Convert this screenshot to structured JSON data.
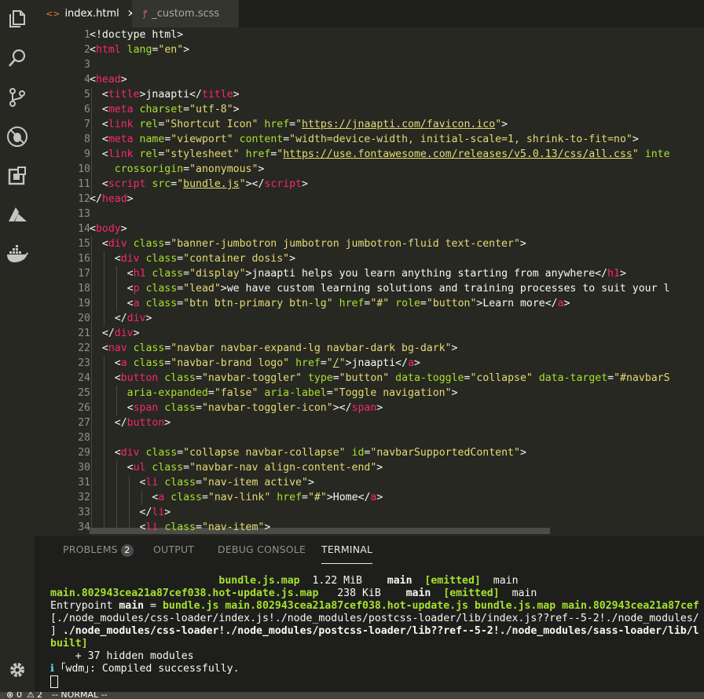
{
  "tabs": [
    {
      "icon": "html-icon",
      "icon_glyph": "<>",
      "label": "index.html",
      "close": "×"
    },
    {
      "icon": "scss-icon",
      "icon_glyph": "ꝭ",
      "label": "_custom.scss"
    }
  ],
  "activity_bar": [
    "files-icon",
    "search-icon",
    "source-control-icon",
    "debug-icon",
    "extensions-icon",
    "azure-icon",
    "docker-icon",
    "settings-gear-icon"
  ],
  "editor": {
    "lines": [
      {
        "n": "1",
        "html": "&lt;!doctype html&gt;"
      },
      {
        "n": "2",
        "html": "&lt;<span class=\"t\">html</span> <span class=\"a\">lang</span>=<span class=\"s\">\"en\"</span>&gt;"
      },
      {
        "n": "3",
        "html": ""
      },
      {
        "n": "4",
        "html": "&lt;<span class=\"t\">head</span>&gt;"
      },
      {
        "n": "5",
        "html": "  &lt;<span class=\"t\">title</span>&gt;jnaapti&lt;/<span class=\"t\">title</span>&gt;"
      },
      {
        "n": "6",
        "html": "  &lt;<span class=\"t\">meta</span> <span class=\"a\">charset</span>=<span class=\"s\">\"utf-8\"</span>&gt;"
      },
      {
        "n": "7",
        "html": "  &lt;<span class=\"t\">link</span> <span class=\"a\">rel</span>=<span class=\"s\">\"Shortcut Icon\"</span> <span class=\"a\">href</span>=<span class=\"s\">\"</span><span class=\"u\">https://jnaapti.com/favicon.ico</span><span class=\"s\">\"</span>&gt;"
      },
      {
        "n": "8",
        "html": "  &lt;<span class=\"t\">meta</span> <span class=\"a\">name</span>=<span class=\"s\">\"viewport\"</span> <span class=\"a\">content</span>=<span class=\"s\">\"width=device-width, initial-scale=1, shrink-to-fit=no\"</span>&gt;"
      },
      {
        "n": "9",
        "html": "  &lt;<span class=\"t\">link</span> <span class=\"a\">rel</span>=<span class=\"s\">\"stylesheet\"</span> <span class=\"a\">href</span>=<span class=\"s\">\"</span><span class=\"u\">https://use.fontawesome.com/releases/v5.0.13/css/all.css</span><span class=\"s\">\"</span> <span class=\"a\">inte</span>"
      },
      {
        "n": "10",
        "html": "    <span class=\"a\">crossorigin</span>=<span class=\"s\">\"anonymous\"</span>&gt;"
      },
      {
        "n": "11",
        "html": "  &lt;<span class=\"t\">script</span> <span class=\"a\">src</span>=<span class=\"s\">\"</span><span class=\"u\">bundle.js</span><span class=\"s\">\"</span>&gt;&lt;/<span class=\"t\">script</span>&gt;"
      },
      {
        "n": "12",
        "html": "&lt;/<span class=\"t\">head</span>&gt;"
      },
      {
        "n": "13",
        "html": ""
      },
      {
        "n": "14",
        "html": "&lt;<span class=\"t\">body</span>&gt;"
      },
      {
        "n": "15",
        "html": "  &lt;<span class=\"t\">div</span> <span class=\"a\">class</span>=<span class=\"s\">\"banner-jumbotron jumbotron jumbotron-fluid text-center\"</span>&gt;"
      },
      {
        "n": "16",
        "html": "    &lt;<span class=\"t\">div</span> <span class=\"a\">class</span>=<span class=\"s\">\"container dosis\"</span>&gt;"
      },
      {
        "n": "17",
        "html": "      &lt;<span class=\"t\">h1</span> <span class=\"a\">class</span>=<span class=\"s\">\"display\"</span>&gt;jnaapti helps you learn anything starting from anywhere&lt;/<span class=\"t\">h1</span>&gt;"
      },
      {
        "n": "18",
        "html": "      &lt;<span class=\"t\">p</span> <span class=\"a\">class</span>=<span class=\"s\">\"lead\"</span>&gt;we have custom learning solutions and training processes to suit your l"
      },
      {
        "n": "19",
        "html": "      &lt;<span class=\"t\">a</span> <span class=\"a\">class</span>=<span class=\"s\">\"btn btn-primary btn-lg\"</span> <span class=\"a\">href</span>=<span class=\"s\">\"#\"</span> <span class=\"a\">role</span>=<span class=\"s\">\"button\"</span>&gt;Learn more&lt;/<span class=\"t\">a</span>&gt;"
      },
      {
        "n": "20",
        "html": "    &lt;/<span class=\"t\">div</span>&gt;"
      },
      {
        "n": "21",
        "html": "  &lt;/<span class=\"t\">div</span>&gt;"
      },
      {
        "n": "22",
        "html": "  &lt;<span class=\"t\">nav</span> <span class=\"a\">class</span>=<span class=\"s\">\"navbar navbar-expand-lg navbar-dark bg-dark\"</span>&gt;"
      },
      {
        "n": "23",
        "html": "    &lt;<span class=\"t\">a</span> <span class=\"a\">class</span>=<span class=\"s\">\"navbar-brand logo\"</span> <span class=\"a\">href</span>=<span class=\"s\">\"</span><span class=\"u\">/</span><span class=\"s\">\"</span>&gt;jnaapti&lt;/<span class=\"t\">a</span>&gt;"
      },
      {
        "n": "24",
        "html": "    &lt;<span class=\"t\">button</span> <span class=\"a\">class</span>=<span class=\"s\">\"navbar-toggler\"</span> <span class=\"a\">type</span>=<span class=\"s\">\"button\"</span> <span class=\"a\">data-toggle</span>=<span class=\"s\">\"collapse\"</span> <span class=\"a\">data-target</span>=<span class=\"s\">\"#navbarS</span>"
      },
      {
        "n": "25",
        "html": "      <span class=\"a\">aria-expanded</span>=<span class=\"s\">\"false\"</span> <span class=\"a\">aria-label</span>=<span class=\"s\">\"Toggle navigation\"</span>&gt;"
      },
      {
        "n": "26",
        "html": "      &lt;<span class=\"t\">span</span> <span class=\"a\">class</span>=<span class=\"s\">\"navbar-toggler-icon\"</span>&gt;&lt;/<span class=\"t\">span</span>&gt;"
      },
      {
        "n": "27",
        "html": "    &lt;/<span class=\"t\">button</span>&gt;"
      },
      {
        "n": "28",
        "html": ""
      },
      {
        "n": "29",
        "html": "    &lt;<span class=\"t\">div</span> <span class=\"a\">class</span>=<span class=\"s\">\"collapse navbar-collapse\"</span> <span class=\"a\">id</span>=<span class=\"s\">\"navbarSupportedContent\"</span>&gt;"
      },
      {
        "n": "30",
        "html": "      &lt;<span class=\"t\">ul</span> <span class=\"a\">class</span>=<span class=\"s\">\"navbar-nav align-content-end\"</span>&gt;"
      },
      {
        "n": "31",
        "html": "        &lt;<span class=\"t\">li</span> <span class=\"a\">class</span>=<span class=\"s\">\"nav-item active\"</span>&gt;"
      },
      {
        "n": "32",
        "html": "          &lt;<span class=\"t\">a</span> <span class=\"a\">class</span>=<span class=\"s\">\"nav-link\"</span> <span class=\"a\">href</span>=<span class=\"s\">\"#\"</span>&gt;Home&lt;/<span class=\"t\">a</span>&gt;"
      },
      {
        "n": "33",
        "html": "        &lt;/<span class=\"t\">li</span>&gt;"
      },
      {
        "n": "34",
        "html": "        &lt;<span class=\"t\">li</span> <span class=\"a\">class</span>=<span class=\"s\">\"nav-item\"</span>&gt;"
      }
    ]
  },
  "panel": {
    "problems_label": "PROBLEMS",
    "problems_count": "2",
    "output_label": "OUTPUT",
    "debug_label": "DEBUG CONSOLE",
    "terminal_label": "TERMINAL"
  },
  "terminal": {
    "lines": [
      {
        "html": "                           <span class=\"g\">bundle.js.map</span>  1.22 MiB    <span class=\"w\">main</span>  <span class=\"g\">[emitted]</span>  main"
      },
      {
        "html": "<span class=\"g\">main.802943cea21a87cef038.hot-update.js.map</span>   238 KiB    <span class=\"w\">main</span>  <span class=\"g\">[emitted]</span>  main"
      },
      {
        "html": "Entrypoint <span class=\"w\">main</span> = <span class=\"g\">bundle.js</span> <span class=\"g\">main.802943cea21a87cef038.hot-update.js</span> <span class=\"g\">bundle.js.map</span> <span class=\"g\">main.802943cea21a87cef</span>"
      },
      {
        "html": "[./node_modules/css-loader/index.js!./node_modules/postcss-loader/lib/index.js??ref--5-2!./node_modules/"
      },
      {
        "html": "] <span class=\"w\">./node_modules/css-loader!./node_modules/postcss-loader/lib??ref--5-2!./node_modules/sass-loader/lib/l</span>"
      },
      {
        "html": "<span class=\"g\">built]</span>"
      },
      {
        "html": "    + 37 hidden modules"
      },
      {
        "html": "<span class=\"cy\">ℹ</span> ｢wdm｣: Compiled successfully."
      },
      {
        "html": "<span class=\"cursor\"></span>"
      }
    ]
  },
  "status_bar": {
    "errors": "0",
    "warnings": "2",
    "mode": "-- NORMAL --"
  }
}
